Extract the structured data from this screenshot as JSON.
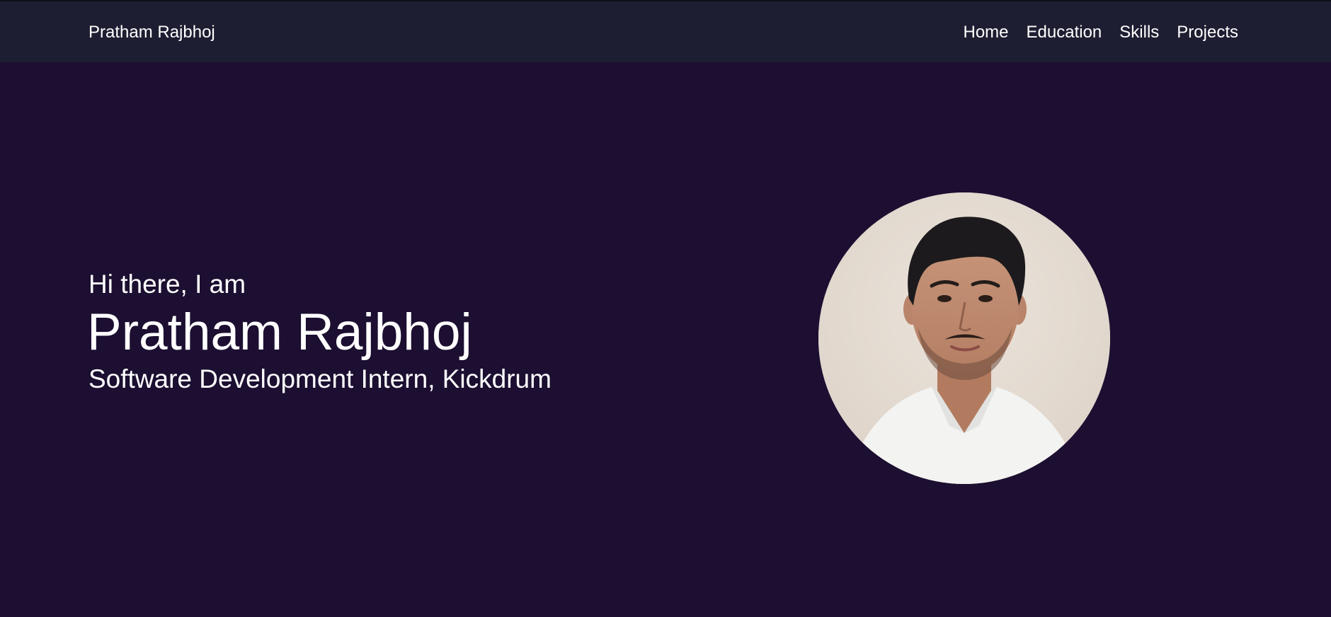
{
  "navbar": {
    "brand": "Pratham Rajbhoj",
    "links": [
      {
        "label": "Home"
      },
      {
        "label": "Education"
      },
      {
        "label": "Skills"
      },
      {
        "label": "Projects"
      }
    ]
  },
  "hero": {
    "greeting": "Hi there, I am",
    "name": "Pratham Rajbhoj",
    "role": "Software Development Intern, Kickdrum"
  },
  "colors": {
    "navbar_bg": "#1e1e32",
    "page_bg": "#1c0f31",
    "text": "#ffffff"
  },
  "icons": {
    "avatar": "profile-photo"
  }
}
